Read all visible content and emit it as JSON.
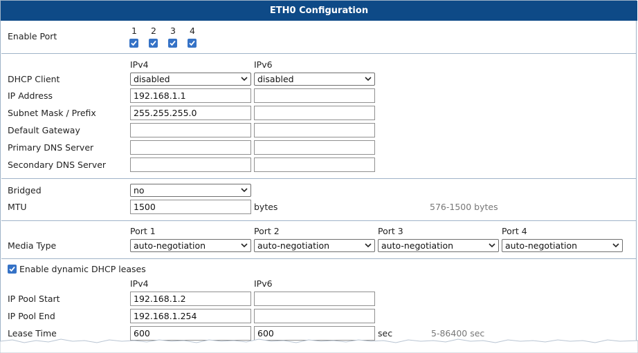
{
  "title": "ETH0 Configuration",
  "enable_port": {
    "label": "Enable Port",
    "ports": [
      {
        "number": "1",
        "checked": true
      },
      {
        "number": "2",
        "checked": true
      },
      {
        "number": "3",
        "checked": true
      },
      {
        "number": "4",
        "checked": true
      }
    ]
  },
  "ip_section": {
    "col_ipv4": "IPv4",
    "col_ipv6": "IPv6",
    "dhcp_client": {
      "label": "DHCP Client",
      "ipv4": "disabled",
      "ipv6": "disabled"
    },
    "ip_address": {
      "label": "IP Address",
      "ipv4": "192.168.1.1",
      "ipv6": ""
    },
    "subnet_mask": {
      "label": "Subnet Mask / Prefix",
      "ipv4": "255.255.255.0",
      "ipv6": ""
    },
    "default_gateway": {
      "label": "Default Gateway",
      "ipv4": "",
      "ipv6": ""
    },
    "primary_dns": {
      "label": "Primary DNS Server",
      "ipv4": "",
      "ipv6": ""
    },
    "secondary_dns": {
      "label": "Secondary DNS Server",
      "ipv4": "",
      "ipv6": ""
    }
  },
  "bridged": {
    "label": "Bridged",
    "value": "no"
  },
  "mtu": {
    "label": "MTU",
    "value": "1500",
    "unit": "bytes",
    "hint": "576-1500 bytes"
  },
  "media_type": {
    "label": "Media Type",
    "ports": [
      {
        "header": "Port 1",
        "value": "auto-negotiation"
      },
      {
        "header": "Port 2",
        "value": "auto-negotiation"
      },
      {
        "header": "Port 3",
        "value": "auto-negotiation"
      },
      {
        "header": "Port 4",
        "value": "auto-negotiation"
      }
    ]
  },
  "dhcp_server": {
    "enable_label": "Enable dynamic DHCP leases",
    "enabled": true,
    "col_ipv4": "IPv4",
    "col_ipv6": "IPv6",
    "pool_start": {
      "label": "IP Pool Start",
      "ipv4": "192.168.1.2",
      "ipv6": ""
    },
    "pool_end": {
      "label": "IP Pool End",
      "ipv4": "192.168.1.254",
      "ipv6": ""
    },
    "lease_time": {
      "label": "Lease Time",
      "ipv4": "600",
      "ipv6": "600",
      "unit": "sec",
      "hint": "5-86400 sec"
    }
  },
  "colors": {
    "title_bar": "#0e4a87",
    "checkbox": "#3572c6",
    "border": "#9fb3c8"
  }
}
